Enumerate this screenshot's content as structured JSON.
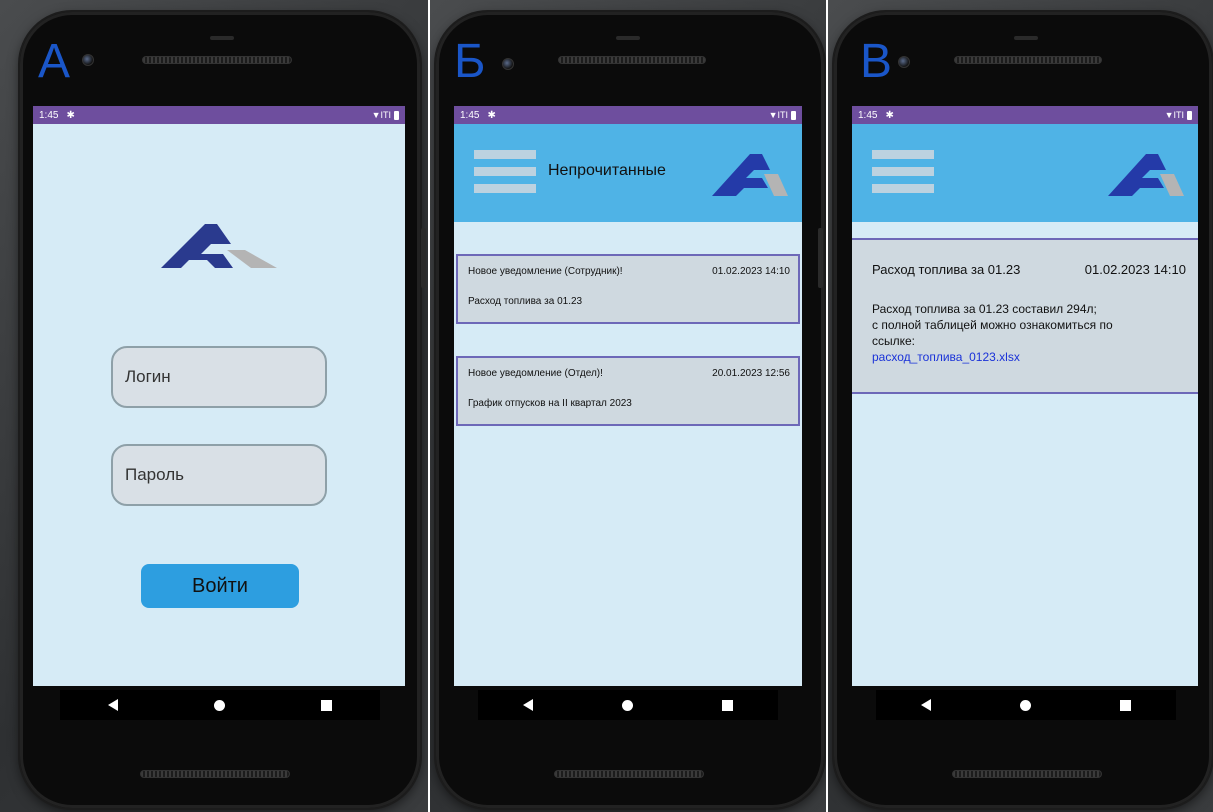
{
  "panels": [
    {
      "letter": "А",
      "status": {
        "time": "1:45",
        "signal": "▼ITI"
      }
    },
    {
      "letter": "Б",
      "status": {
        "time": "1:45",
        "signal": "▼ITI"
      },
      "appbar_title": "Непрочитанные",
      "cards": [
        {
          "title": "Новое уведомление (Сотрудник)!",
          "date": "01.02.2023 14:10",
          "body": "Расход топлива за 01.23"
        },
        {
          "title": "Новое уведомление (Отдел)!",
          "date": "20.01.2023 12:56",
          "body": "График отпусков на II квартал 2023"
        }
      ]
    },
    {
      "letter": "В",
      "status": {
        "time": "1:45",
        "signal": "▼ITI"
      },
      "detail": {
        "title": "Расход топлива за 01.23",
        "date": "01.02.2023 14:10",
        "line1": "Расход топлива за 01.23 составил 294л;",
        "line2": "с полной таблицей можно ознакомиться по",
        "line3": "ссылке:",
        "link": "расход_топлива_0123.xlsx"
      }
    }
  ],
  "login": {
    "login_placeholder": "Логин",
    "password_placeholder": "Пароль",
    "button_label": "Войти"
  },
  "colors": {
    "statusbar": "#6e4e9e",
    "appbar": "#4fb3e6",
    "screen_bg": "#d6ebf6",
    "button": "#2d9ee0",
    "card_border": "#6d68b8",
    "logo_blue": "#2a3a8e",
    "logo_grey": "#b4b4b4",
    "letter_blue": "#1a56c8",
    "link": "#1a32d8"
  }
}
